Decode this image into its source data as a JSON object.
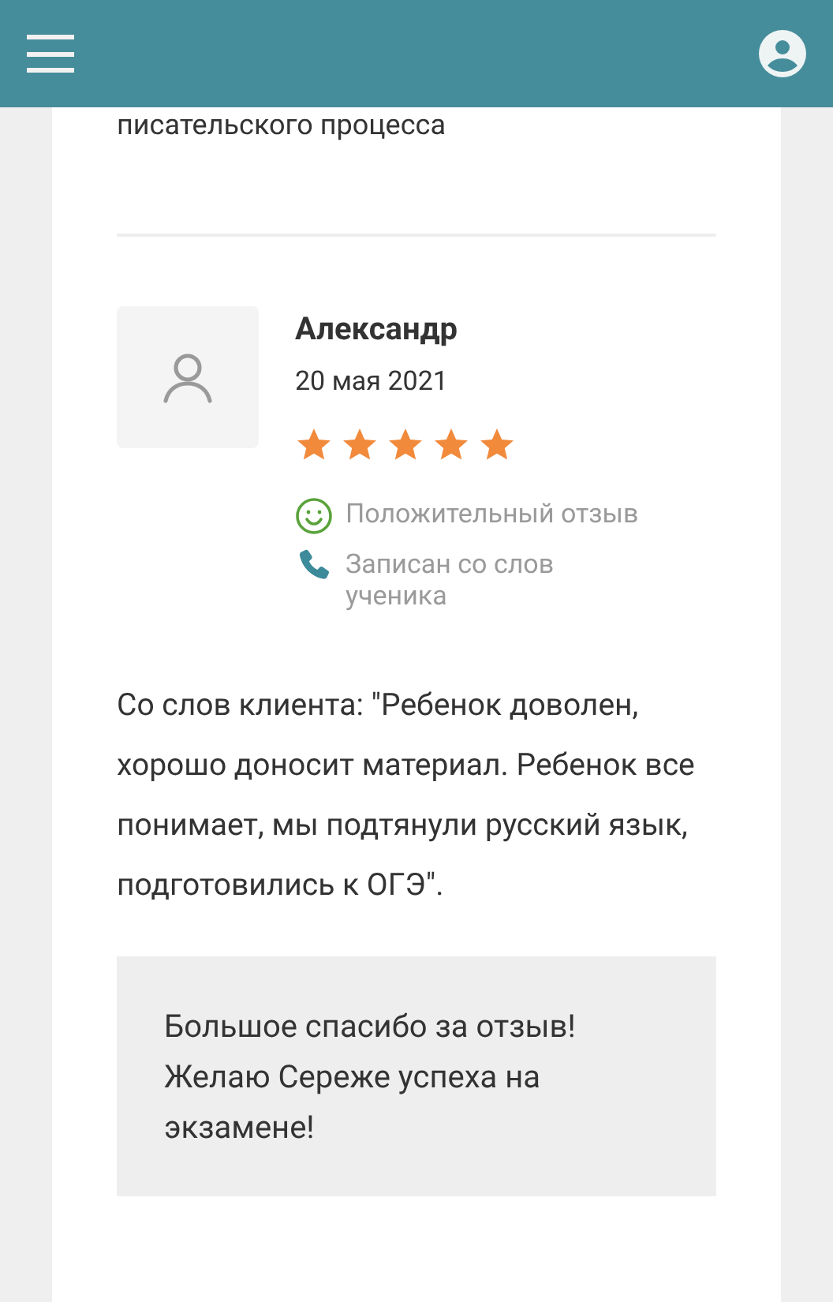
{
  "previous_text": "писательского процесса",
  "review": {
    "author": "Александр",
    "date": "20 мая 2021",
    "stars": 5,
    "tags": [
      {
        "kind": "positive",
        "label": "Положительный отзыв"
      },
      {
        "kind": "phone",
        "label": "Записан со слов ученика"
      }
    ],
    "text": "Со слов клиента: \"Ребенок доволен, хорошо доносит материал. Ребенок все понимает, мы подтянули русский язык, подготовились к ОГЭ\".",
    "reply": "Большое спасибо за отзыв! Желаю Сереже успеха на экзамене!"
  }
}
